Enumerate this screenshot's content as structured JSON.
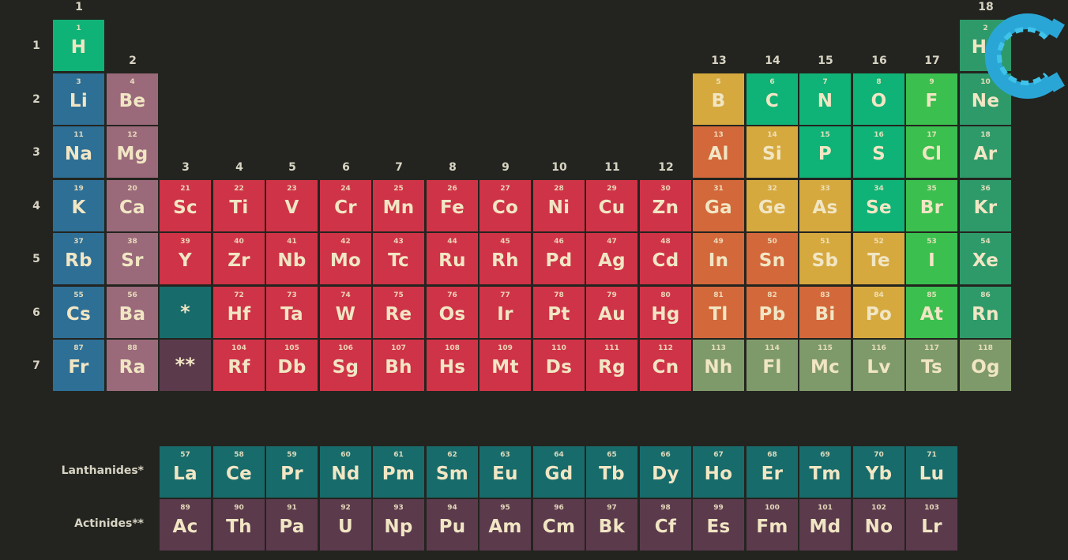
{
  "groups": [
    "1",
    "2",
    "3",
    "4",
    "5",
    "6",
    "7",
    "8",
    "9",
    "10",
    "11",
    "12",
    "13",
    "14",
    "15",
    "16",
    "17",
    "18"
  ],
  "periods": [
    "1",
    "2",
    "3",
    "4",
    "5",
    "6",
    "7"
  ],
  "colors": {
    "alkali": "#2e6f96",
    "alkaline": "#9a6a7a",
    "transition": "#cf3347",
    "post": "#d3683a",
    "metalloid": "#d6a93f",
    "nonmetal": "#10b377",
    "halogen": "#3bbf4e",
    "noble": "#2e9a6a",
    "unknown": "#7f9a6a",
    "lanth": "#186b6b",
    "act": "#5b3a4c",
    "hydrogen": "#10b377"
  },
  "elements": [
    {
      "n": "1",
      "s": "H",
      "g": 1,
      "p": 1,
      "c": "hydrogen"
    },
    {
      "n": "2",
      "s": "He",
      "g": 18,
      "p": 1,
      "c": "noble"
    },
    {
      "n": "3",
      "s": "Li",
      "g": 1,
      "p": 2,
      "c": "alkali"
    },
    {
      "n": "4",
      "s": "Be",
      "g": 2,
      "p": 2,
      "c": "alkaline"
    },
    {
      "n": "5",
      "s": "B",
      "g": 13,
      "p": 2,
      "c": "metalloid"
    },
    {
      "n": "6",
      "s": "C",
      "g": 14,
      "p": 2,
      "c": "nonmetal"
    },
    {
      "n": "7",
      "s": "N",
      "g": 15,
      "p": 2,
      "c": "nonmetal"
    },
    {
      "n": "8",
      "s": "O",
      "g": 16,
      "p": 2,
      "c": "nonmetal"
    },
    {
      "n": "9",
      "s": "F",
      "g": 17,
      "p": 2,
      "c": "halogen"
    },
    {
      "n": "10",
      "s": "Ne",
      "g": 18,
      "p": 2,
      "c": "noble"
    },
    {
      "n": "11",
      "s": "Na",
      "g": 1,
      "p": 3,
      "c": "alkali"
    },
    {
      "n": "12",
      "s": "Mg",
      "g": 2,
      "p": 3,
      "c": "alkaline"
    },
    {
      "n": "13",
      "s": "Al",
      "g": 13,
      "p": 3,
      "c": "post"
    },
    {
      "n": "14",
      "s": "Si",
      "g": 14,
      "p": 3,
      "c": "metalloid"
    },
    {
      "n": "15",
      "s": "P",
      "g": 15,
      "p": 3,
      "c": "nonmetal"
    },
    {
      "n": "16",
      "s": "S",
      "g": 16,
      "p": 3,
      "c": "nonmetal"
    },
    {
      "n": "17",
      "s": "Cl",
      "g": 17,
      "p": 3,
      "c": "halogen"
    },
    {
      "n": "18",
      "s": "Ar",
      "g": 18,
      "p": 3,
      "c": "noble"
    },
    {
      "n": "19",
      "s": "K",
      "g": 1,
      "p": 4,
      "c": "alkali"
    },
    {
      "n": "20",
      "s": "Ca",
      "g": 2,
      "p": 4,
      "c": "alkaline"
    },
    {
      "n": "21",
      "s": "Sc",
      "g": 3,
      "p": 4,
      "c": "transition"
    },
    {
      "n": "22",
      "s": "Ti",
      "g": 4,
      "p": 4,
      "c": "transition"
    },
    {
      "n": "23",
      "s": "V",
      "g": 5,
      "p": 4,
      "c": "transition"
    },
    {
      "n": "24",
      "s": "Cr",
      "g": 6,
      "p": 4,
      "c": "transition"
    },
    {
      "n": "25",
      "s": "Mn",
      "g": 7,
      "p": 4,
      "c": "transition"
    },
    {
      "n": "26",
      "s": "Fe",
      "g": 8,
      "p": 4,
      "c": "transition"
    },
    {
      "n": "27",
      "s": "Co",
      "g": 9,
      "p": 4,
      "c": "transition"
    },
    {
      "n": "28",
      "s": "Ni",
      "g": 10,
      "p": 4,
      "c": "transition"
    },
    {
      "n": "29",
      "s": "Cu",
      "g": 11,
      "p": 4,
      "c": "transition"
    },
    {
      "n": "30",
      "s": "Zn",
      "g": 12,
      "p": 4,
      "c": "transition"
    },
    {
      "n": "31",
      "s": "Ga",
      "g": 13,
      "p": 4,
      "c": "post"
    },
    {
      "n": "32",
      "s": "Ge",
      "g": 14,
      "p": 4,
      "c": "metalloid"
    },
    {
      "n": "33",
      "s": "As",
      "g": 15,
      "p": 4,
      "c": "metalloid"
    },
    {
      "n": "34",
      "s": "Se",
      "g": 16,
      "p": 4,
      "c": "nonmetal"
    },
    {
      "n": "35",
      "s": "Br",
      "g": 17,
      "p": 4,
      "c": "halogen"
    },
    {
      "n": "36",
      "s": "Kr",
      "g": 18,
      "p": 4,
      "c": "noble"
    },
    {
      "n": "37",
      "s": "Rb",
      "g": 1,
      "p": 5,
      "c": "alkali"
    },
    {
      "n": "38",
      "s": "Sr",
      "g": 2,
      "p": 5,
      "c": "alkaline"
    },
    {
      "n": "39",
      "s": "Y",
      "g": 3,
      "p": 5,
      "c": "transition"
    },
    {
      "n": "40",
      "s": "Zr",
      "g": 4,
      "p": 5,
      "c": "transition"
    },
    {
      "n": "41",
      "s": "Nb",
      "g": 5,
      "p": 5,
      "c": "transition"
    },
    {
      "n": "42",
      "s": "Mo",
      "g": 6,
      "p": 5,
      "c": "transition"
    },
    {
      "n": "43",
      "s": "Tc",
      "g": 7,
      "p": 5,
      "c": "transition"
    },
    {
      "n": "44",
      "s": "Ru",
      "g": 8,
      "p": 5,
      "c": "transition"
    },
    {
      "n": "45",
      "s": "Rh",
      "g": 9,
      "p": 5,
      "c": "transition"
    },
    {
      "n": "46",
      "s": "Pd",
      "g": 10,
      "p": 5,
      "c": "transition"
    },
    {
      "n": "47",
      "s": "Ag",
      "g": 11,
      "p": 5,
      "c": "transition"
    },
    {
      "n": "48",
      "s": "Cd",
      "g": 12,
      "p": 5,
      "c": "transition"
    },
    {
      "n": "49",
      "s": "In",
      "g": 13,
      "p": 5,
      "c": "post"
    },
    {
      "n": "50",
      "s": "Sn",
      "g": 14,
      "p": 5,
      "c": "post"
    },
    {
      "n": "51",
      "s": "Sb",
      "g": 15,
      "p": 5,
      "c": "metalloid"
    },
    {
      "n": "52",
      "s": "Te",
      "g": 16,
      "p": 5,
      "c": "metalloid"
    },
    {
      "n": "53",
      "s": "I",
      "g": 17,
      "p": 5,
      "c": "halogen"
    },
    {
      "n": "54",
      "s": "Xe",
      "g": 18,
      "p": 5,
      "c": "noble"
    },
    {
      "n": "55",
      "s": "Cs",
      "g": 1,
      "p": 6,
      "c": "alkali"
    },
    {
      "n": "56",
      "s": "Ba",
      "g": 2,
      "p": 6,
      "c": "alkaline"
    },
    {
      "n": "",
      "s": "*",
      "g": 3,
      "p": 6,
      "c": "lanth",
      "star": true
    },
    {
      "n": "72",
      "s": "Hf",
      "g": 4,
      "p": 6,
      "c": "transition"
    },
    {
      "n": "73",
      "s": "Ta",
      "g": 5,
      "p": 6,
      "c": "transition"
    },
    {
      "n": "74",
      "s": "W",
      "g": 6,
      "p": 6,
      "c": "transition"
    },
    {
      "n": "75",
      "s": "Re",
      "g": 7,
      "p": 6,
      "c": "transition"
    },
    {
      "n": "76",
      "s": "Os",
      "g": 8,
      "p": 6,
      "c": "transition"
    },
    {
      "n": "77",
      "s": "Ir",
      "g": 9,
      "p": 6,
      "c": "transition"
    },
    {
      "n": "78",
      "s": "Pt",
      "g": 10,
      "p": 6,
      "c": "transition"
    },
    {
      "n": "79",
      "s": "Au",
      "g": 11,
      "p": 6,
      "c": "transition"
    },
    {
      "n": "80",
      "s": "Hg",
      "g": 12,
      "p": 6,
      "c": "transition"
    },
    {
      "n": "81",
      "s": "Tl",
      "g": 13,
      "p": 6,
      "c": "post"
    },
    {
      "n": "82",
      "s": "Pb",
      "g": 14,
      "p": 6,
      "c": "post"
    },
    {
      "n": "83",
      "s": "Bi",
      "g": 15,
      "p": 6,
      "c": "post"
    },
    {
      "n": "84",
      "s": "Po",
      "g": 16,
      "p": 6,
      "c": "metalloid"
    },
    {
      "n": "85",
      "s": "At",
      "g": 17,
      "p": 6,
      "c": "halogen"
    },
    {
      "n": "86",
      "s": "Rn",
      "g": 18,
      "p": 6,
      "c": "noble"
    },
    {
      "n": "87",
      "s": "Fr",
      "g": 1,
      "p": 7,
      "c": "alkali"
    },
    {
      "n": "88",
      "s": "Ra",
      "g": 2,
      "p": 7,
      "c": "alkaline"
    },
    {
      "n": "",
      "s": "**",
      "g": 3,
      "p": 7,
      "c": "act",
      "star": true
    },
    {
      "n": "104",
      "s": "Rf",
      "g": 4,
      "p": 7,
      "c": "transition"
    },
    {
      "n": "105",
      "s": "Db",
      "g": 5,
      "p": 7,
      "c": "transition"
    },
    {
      "n": "106",
      "s": "Sg",
      "g": 6,
      "p": 7,
      "c": "transition"
    },
    {
      "n": "107",
      "s": "Bh",
      "g": 7,
      "p": 7,
      "c": "transition"
    },
    {
      "n": "108",
      "s": "Hs",
      "g": 8,
      "p": 7,
      "c": "transition"
    },
    {
      "n": "109",
      "s": "Mt",
      "g": 9,
      "p": 7,
      "c": "transition"
    },
    {
      "n": "110",
      "s": "Ds",
      "g": 10,
      "p": 7,
      "c": "transition"
    },
    {
      "n": "111",
      "s": "Rg",
      "g": 11,
      "p": 7,
      "c": "transition"
    },
    {
      "n": "112",
      "s": "Cn",
      "g": 12,
      "p": 7,
      "c": "transition"
    },
    {
      "n": "113",
      "s": "Nh",
      "g": 13,
      "p": 7,
      "c": "unknown"
    },
    {
      "n": "114",
      "s": "Fl",
      "g": 14,
      "p": 7,
      "c": "unknown"
    },
    {
      "n": "115",
      "s": "Mc",
      "g": 15,
      "p": 7,
      "c": "unknown"
    },
    {
      "n": "116",
      "s": "Lv",
      "g": 16,
      "p": 7,
      "c": "unknown"
    },
    {
      "n": "117",
      "s": "Ts",
      "g": 17,
      "p": 7,
      "c": "unknown"
    },
    {
      "n": "118",
      "s": "Og",
      "g": 18,
      "p": 7,
      "c": "unknown"
    }
  ],
  "series": [
    {
      "label": "Lanthanides*",
      "c": "lanth",
      "items": [
        {
          "n": "57",
          "s": "La"
        },
        {
          "n": "58",
          "s": "Ce"
        },
        {
          "n": "59",
          "s": "Pr"
        },
        {
          "n": "60",
          "s": "Nd"
        },
        {
          "n": "61",
          "s": "Pm"
        },
        {
          "n": "62",
          "s": "Sm"
        },
        {
          "n": "63",
          "s": "Eu"
        },
        {
          "n": "64",
          "s": "Gd"
        },
        {
          "n": "65",
          "s": "Tb"
        },
        {
          "n": "66",
          "s": "Dy"
        },
        {
          "n": "67",
          "s": "Ho"
        },
        {
          "n": "68",
          "s": "Er"
        },
        {
          "n": "69",
          "s": "Tm"
        },
        {
          "n": "70",
          "s": "Yb"
        },
        {
          "n": "71",
          "s": "Lu"
        }
      ]
    },
    {
      "label": "Actinides**",
      "c": "act",
      "items": [
        {
          "n": "89",
          "s": "Ac"
        },
        {
          "n": "90",
          "s": "Th"
        },
        {
          "n": "91",
          "s": "Pa"
        },
        {
          "n": "92",
          "s": "U"
        },
        {
          "n": "93",
          "s": "Np"
        },
        {
          "n": "94",
          "s": "Pu"
        },
        {
          "n": "95",
          "s": "Am"
        },
        {
          "n": "96",
          "s": "Cm"
        },
        {
          "n": "97",
          "s": "Bk"
        },
        {
          "n": "98",
          "s": "Cf"
        },
        {
          "n": "99",
          "s": "Es"
        },
        {
          "n": "100",
          "s": "Fm"
        },
        {
          "n": "101",
          "s": "Md"
        },
        {
          "n": "102",
          "s": "No"
        },
        {
          "n": "103",
          "s": "Lr"
        }
      ]
    }
  ],
  "logo": {
    "icon": "c-logo-icon",
    "color": "#2aa6d6"
  }
}
